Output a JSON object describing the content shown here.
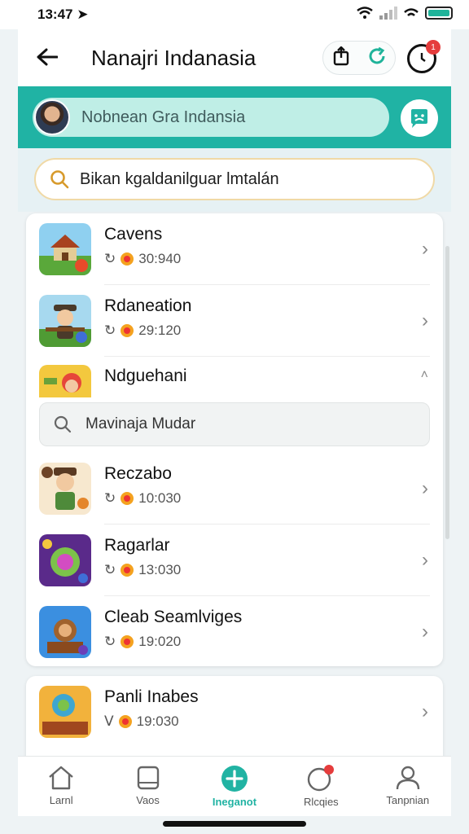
{
  "status_bar": {
    "time": "13:47 ➤"
  },
  "header": {
    "title": "Nanajri Indanasia",
    "notification_count": "1"
  },
  "banner": {
    "profile_name": "Nobnean Gra Indansia"
  },
  "search": {
    "placeholder": "Bikan kgaldanilguar lmtalán"
  },
  "list": {
    "items": [
      {
        "title": "Cavens",
        "count": "30:940"
      },
      {
        "title": "Rdaneation",
        "count": "29:120"
      },
      {
        "title": "Ndguehani",
        "count": ""
      },
      {
        "title": "Reczabo",
        "count": "10:030"
      },
      {
        "title": "Ragarlar",
        "count": "13:030"
      },
      {
        "title": "Cleab Seamlviges",
        "count": "19:020"
      },
      {
        "title": "Panli Inabes",
        "count": "19:030"
      }
    ],
    "inner_search_placeholder": "Mavinaja Mudar"
  },
  "nav": {
    "items": [
      {
        "label": "Larnl"
      },
      {
        "label": "Vaos"
      },
      {
        "label": "Ineganot"
      },
      {
        "label": "Rlcqies"
      },
      {
        "label": "Tanpnian"
      }
    ]
  },
  "colors": {
    "accent": "#20b3a4",
    "badge": "#e53c3c",
    "coin": "#f4a21f"
  }
}
